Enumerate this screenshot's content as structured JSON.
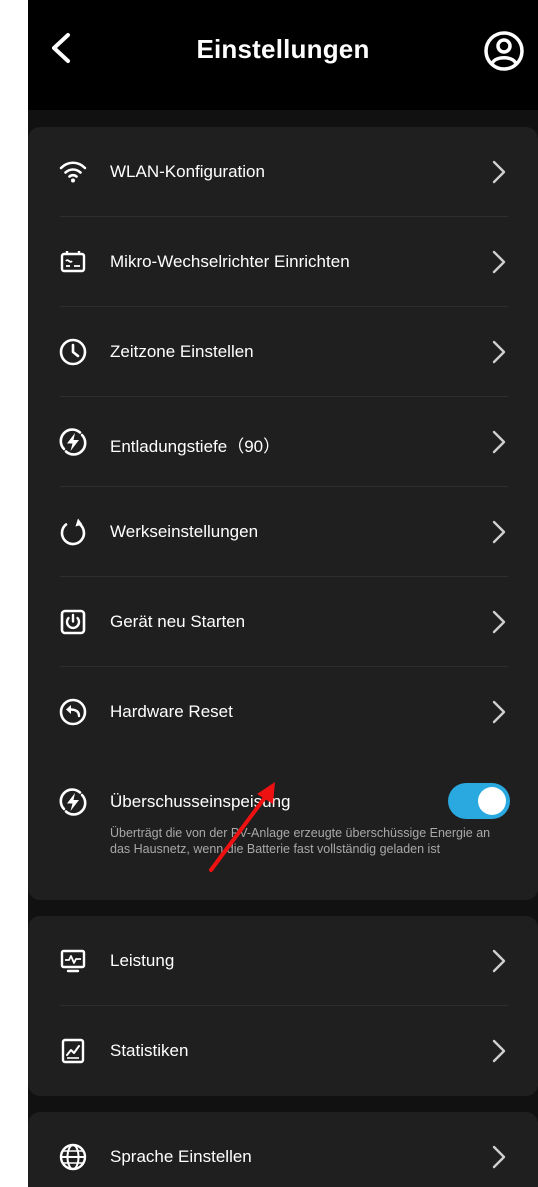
{
  "header": {
    "title": "Einstellungen",
    "back_icon": "chevron-left-icon",
    "profile_icon": "user-circle-icon"
  },
  "colors": {
    "background": "#111111",
    "header": "#000000",
    "card": "#1f1f1f",
    "text": "#ffffff",
    "secondary_text": "#a8a8a8",
    "accent": "#2aa9e0",
    "annotation": "#ee1111"
  },
  "groups": [
    {
      "items": [
        {
          "label": "WLAN-Konfiguration",
          "icon": "wifi-icon"
        },
        {
          "label": "Mikro-Wechselrichter Einrichten",
          "icon": "inverter-icon"
        },
        {
          "label": "Zeitzone Einstellen",
          "icon": "clock-icon"
        },
        {
          "label": "Entladungstiefe（90）",
          "icon": "lightning-circle-icon"
        },
        {
          "label": "Werkseinstellungen",
          "icon": "refresh-icon"
        },
        {
          "label": "Gerät neu Starten",
          "icon": "power-icon"
        },
        {
          "label": "Hardware Reset",
          "icon": "reset-arrow-icon"
        }
      ],
      "toggle_item": {
        "label": "Überschusseinspeisung",
        "description": "Überträgt die von der PV-Anlage erzeugte überschüssige Energie an das Hausnetz, wenn die Batterie fast vollständig geladen ist",
        "enabled": true,
        "icon": "lightning-circle-icon"
      }
    },
    {
      "items": [
        {
          "label": "Leistung",
          "icon": "monitor-chart-icon"
        },
        {
          "label": "Statistiken",
          "icon": "stats-icon"
        }
      ]
    },
    {
      "items": [
        {
          "label": "Sprache Einstellen",
          "icon": "globe-icon"
        }
      ]
    }
  ]
}
